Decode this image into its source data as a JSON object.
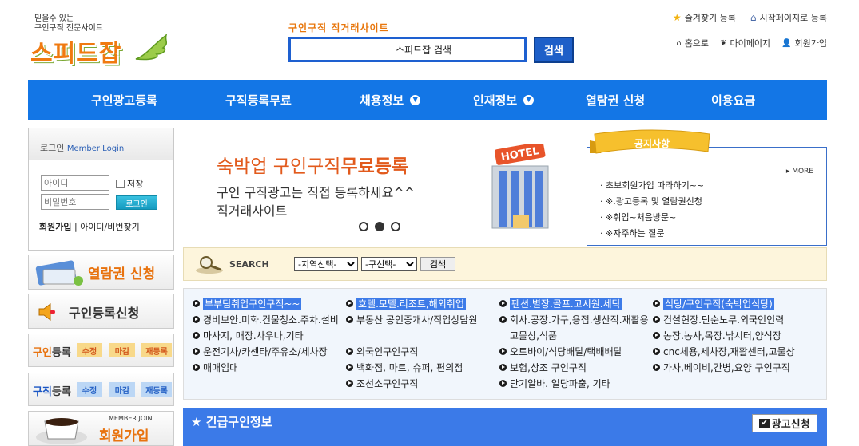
{
  "header": {
    "logo_tag1": "믿을수 있는",
    "logo_tag2": "구인구직 전문사이트",
    "logo_brand": "스피드잡",
    "site_tag": "구인구직 직거래사이트",
    "search_value": "스피드잡 검색",
    "search_button": "검색",
    "bookmark": "즐겨찾기 등록",
    "homepage": "시작페이지로 등록",
    "home": "홈으로",
    "mypage": "마이페이지",
    "join": "회원가입"
  },
  "nav": {
    "items": [
      "구인광고등록",
      "구직등록무료",
      "채용정보",
      "인재정보",
      "열람권 신청",
      "이용요금"
    ]
  },
  "login": {
    "title": "로그인",
    "title_en": "Member Login",
    "id_placeholder": "아이디",
    "pw_placeholder": "비밀번호",
    "save": "저장",
    "login_button": "로그인",
    "join": "회원가입",
    "find": "아이디/비번찾기"
  },
  "side": {
    "view_apply": "열람권 신청",
    "job_register": "구인등록신청",
    "recruit_label_hl": "구인",
    "recruit_label": "등록",
    "seek_label_hl": "구직",
    "seek_label": "등록",
    "edit": "수정",
    "close": "마감",
    "reregister": "재등록",
    "member_join_en": "MEMBER JOIN",
    "member_join": "회원가입"
  },
  "banner": {
    "line1_a": "숙박업 구인구직",
    "line1_b": "무료등록",
    "line2": "구인 구직광고는 직접 등록하세요^^",
    "line3": "직거래사이트",
    "hotel_sign": "HOTEL",
    "active_slide": 2,
    "slide_count": 3
  },
  "notice": {
    "title": "공지사항",
    "more": "MORE",
    "items": [
      "초보회원가입 따라하기~~",
      "※.광고등록 및 열람권신청",
      "※취업~처음방문~",
      "※자주하는 질문"
    ]
  },
  "search": {
    "label": "SEARCH",
    "region": "-지역선택-",
    "category": "-구선택-",
    "button": "검색"
  },
  "categories": {
    "col1": [
      "부부팀취업구인구직~~",
      "경비보안.미화.건물청소.주차.설비",
      "마사지, 매장.사우나,기타",
      "운전기사/카센타/주유소/세차장",
      "매매임대"
    ],
    "col2": [
      "호텔.모텔.리조트,해외취업",
      "부동산 공인중개사/직업상담원",
      "외국인구인구직",
      "백화점, 마트, 슈퍼, 편의점",
      "조선소구인구직"
    ],
    "col3": [
      "펜션.별장.골프.고시원.세탁",
      "회사.공장.가구,용접.생산직.재활용고물상,식품",
      "오토바이/식당배달/택배배달",
      "보험,상조 구인구직",
      "단기알바. 일당파출, 기타"
    ],
    "col4": [
      "식당/구인구직(숙박업식당)",
      "건설현장.단순노무.외국인인력",
      "농장.농사,목장.낚시터,양식장",
      "cnc체용,세차장,재활센터,고물상",
      "가사,베이비,간병,요양 구인구직"
    ]
  },
  "urgent": {
    "title": "긴급구인정보",
    "apply": "광고신청"
  }
}
